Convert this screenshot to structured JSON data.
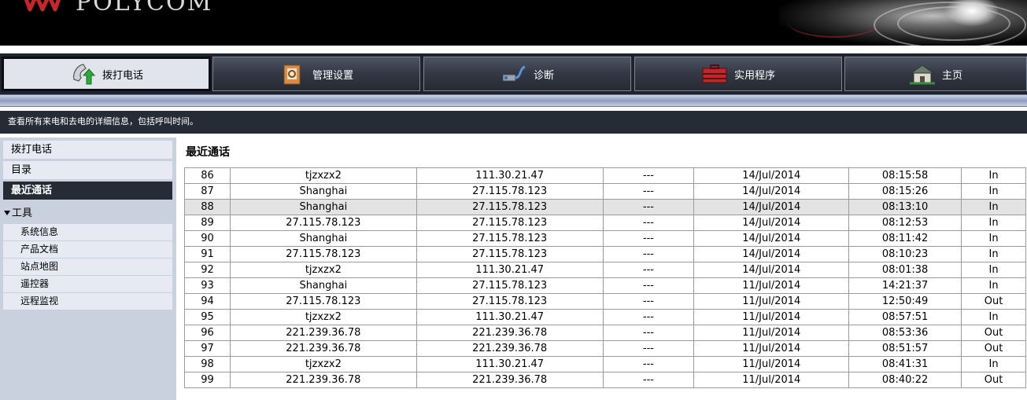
{
  "header": {
    "brand": "POLYCOM"
  },
  "nav": {
    "tabs": [
      {
        "label": "拨打电话",
        "icon": "phone-icon",
        "active": true
      },
      {
        "label": "管理设置",
        "icon": "settings-box-icon",
        "active": false
      },
      {
        "label": "诊断",
        "icon": "diagnostics-cable-icon",
        "active": false
      },
      {
        "label": "实用程序",
        "icon": "toolbox-icon",
        "active": false
      },
      {
        "label": "主页",
        "icon": "home-icon",
        "active": false
      }
    ]
  },
  "description": "查看所有来电和去电的详细信息，包括呼叫时间。",
  "sidebar": {
    "items": [
      {
        "label": "拨打电话"
      },
      {
        "label": "目录"
      },
      {
        "label": "最近通话",
        "active": true
      }
    ],
    "tools_label": "工具",
    "tools": [
      {
        "label": "系统信息"
      },
      {
        "label": "产品文档"
      },
      {
        "label": "站点地图"
      },
      {
        "label": "遥控器"
      },
      {
        "label": "远程监视"
      }
    ]
  },
  "main": {
    "title": "最近通话",
    "rows": [
      {
        "no": "86",
        "name": "tjzxzx2",
        "address": "111.30.21.47",
        "extra": "---",
        "date": "14/Jul/2014",
        "time": "08:15:58",
        "dir": "In"
      },
      {
        "no": "87",
        "name": "Shanghai",
        "address": "27.115.78.123",
        "extra": "---",
        "date": "14/Jul/2014",
        "time": "08:15:26",
        "dir": "In"
      },
      {
        "no": "88",
        "name": "Shanghai",
        "address": "27.115.78.123",
        "extra": "---",
        "date": "14/Jul/2014",
        "time": "08:13:10",
        "dir": "In",
        "highlight": true
      },
      {
        "no": "89",
        "name": "27.115.78.123",
        "address": "27.115.78.123",
        "extra": "---",
        "date": "14/Jul/2014",
        "time": "08:12:53",
        "dir": "In"
      },
      {
        "no": "90",
        "name": "Shanghai",
        "address": "27.115.78.123",
        "extra": "---",
        "date": "14/Jul/2014",
        "time": "08:11:42",
        "dir": "In"
      },
      {
        "no": "91",
        "name": "27.115.78.123",
        "address": "27.115.78.123",
        "extra": "---",
        "date": "14/Jul/2014",
        "time": "08:10:23",
        "dir": "In"
      },
      {
        "no": "92",
        "name": "tjzxzx2",
        "address": "111.30.21.47",
        "extra": "---",
        "date": "14/Jul/2014",
        "time": "08:01:38",
        "dir": "In"
      },
      {
        "no": "93",
        "name": "Shanghai",
        "address": "27.115.78.123",
        "extra": "---",
        "date": "11/Jul/2014",
        "time": "14:21:37",
        "dir": "In"
      },
      {
        "no": "94",
        "name": "27.115.78.123",
        "address": "27.115.78.123",
        "extra": "---",
        "date": "11/Jul/2014",
        "time": "12:50:49",
        "dir": "Out"
      },
      {
        "no": "95",
        "name": "tjzxzx2",
        "address": "111.30.21.47",
        "extra": "---",
        "date": "11/Jul/2014",
        "time": "08:57:51",
        "dir": "In"
      },
      {
        "no": "96",
        "name": "221.239.36.78",
        "address": "221.239.36.78",
        "extra": "---",
        "date": "11/Jul/2014",
        "time": "08:53:36",
        "dir": "Out"
      },
      {
        "no": "97",
        "name": "221.239.36.78",
        "address": "221.239.36.78",
        "extra": "---",
        "date": "11/Jul/2014",
        "time": "08:51:57",
        "dir": "Out"
      },
      {
        "no": "98",
        "name": "tjzxzx2",
        "address": "111.30.21.47",
        "extra": "---",
        "date": "11/Jul/2014",
        "time": "08:41:31",
        "dir": "In"
      },
      {
        "no": "99",
        "name": "221.239.36.78",
        "address": "221.239.36.78",
        "extra": "---",
        "date": "11/Jul/2014",
        "time": "08:40:22",
        "dir": "Out"
      }
    ]
  },
  "colors": {
    "header_bg": "#000000",
    "nav_bg": "#1f232b",
    "active_tab_bg": "#e1e4ec",
    "sidebar_bg": "#c9d0de",
    "sidebar_active_bg": "#262c36",
    "highlight_row_bg": "#e3e3e3"
  }
}
